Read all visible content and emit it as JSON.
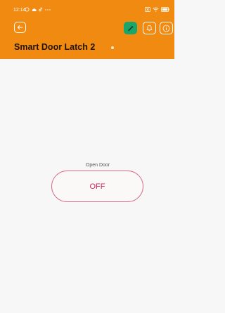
{
  "status_bar": {
    "time": "12:14",
    "left_icons": [
      "whatsapp-icon",
      "cloud-icon",
      "tiktok-icon",
      "more-dots-icon"
    ],
    "right_icons": [
      "close-box-icon",
      "wifi-icon",
      "battery-icon"
    ]
  },
  "header": {
    "device_name": "Smart Door Latch 2",
    "online_indicator": "online-dot",
    "buttons": [
      "back-icon",
      "wrench-icon",
      "bell-icon",
      "info-icon"
    ],
    "colors": {
      "header_bg": "#f18a10",
      "wrench_button_bg": "#1aa56b"
    }
  },
  "control": {
    "label": "Open Door",
    "state": "OFF",
    "colors": {
      "toggle_border": "#d76b8a",
      "toggle_text": "#d2245d"
    }
  }
}
